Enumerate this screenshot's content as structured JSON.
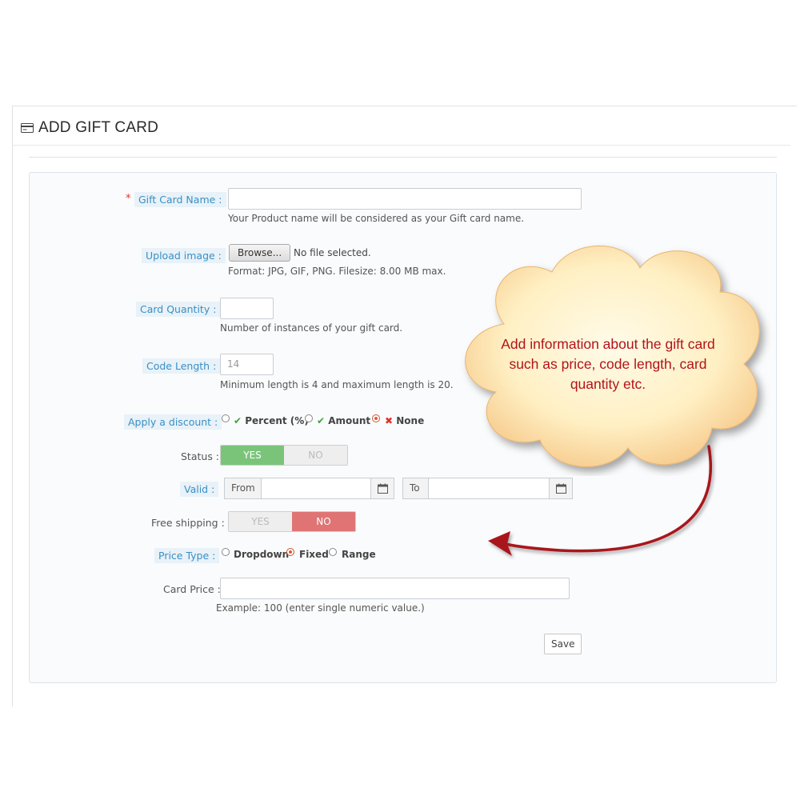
{
  "header": {
    "title": "ADD GIFT CARD",
    "icon": "credit-card-icon"
  },
  "form": {
    "gift_card_name": {
      "required_mark": "*",
      "label": "Gift Card Name :",
      "value": "",
      "help": "Your Product name will be considered as your Gift card name."
    },
    "upload_image": {
      "label": "Upload image :",
      "browse_label": "Browse...",
      "file_status": "No file selected.",
      "help": "Format: JPG, GIF, PNG. Filesize: 8.00 MB max."
    },
    "card_quantity": {
      "label": "Card Quantity :",
      "value": "",
      "help": "Number of instances of your gift card."
    },
    "code_length": {
      "label": "Code Length :",
      "placeholder": "14",
      "help": "Minimum length is 4 and maximum length is 20."
    },
    "discount": {
      "label": "Apply a discount :",
      "options": [
        {
          "label": "Percent (%)",
          "mark": "✔",
          "selected": false
        },
        {
          "label": "Amount",
          "mark": "✔",
          "selected": false
        },
        {
          "label": "None",
          "mark": "✖",
          "selected": true
        }
      ]
    },
    "status": {
      "label": "Status :",
      "yes": "YES",
      "no": "NO",
      "value": "YES"
    },
    "valid": {
      "label": "Valid :",
      "from": "From",
      "to": "To"
    },
    "free_shipping": {
      "label": "Free shipping :",
      "yes": "YES",
      "no": "NO",
      "value": "NO"
    },
    "price_type": {
      "label": "Price Type :",
      "options": [
        {
          "label": "Dropdown",
          "selected": false
        },
        {
          "label": "Fixed",
          "selected": true
        },
        {
          "label": "Range",
          "selected": false
        }
      ]
    },
    "card_price": {
      "label": "Card Price :",
      "value": "",
      "help": "Example: 100 (enter single numeric value.)"
    },
    "save_label": "Save"
  },
  "callout": {
    "line1": "Add information about the gift card",
    "line2": "such as price, code length, card",
    "line3": "quantity etc."
  },
  "colors": {
    "label_highlight": "#3a8fc5",
    "switch_yes": "#7ac47a",
    "switch_no": "#e07474",
    "callout_text": "#b3131b",
    "arrow": "#a8141c"
  }
}
